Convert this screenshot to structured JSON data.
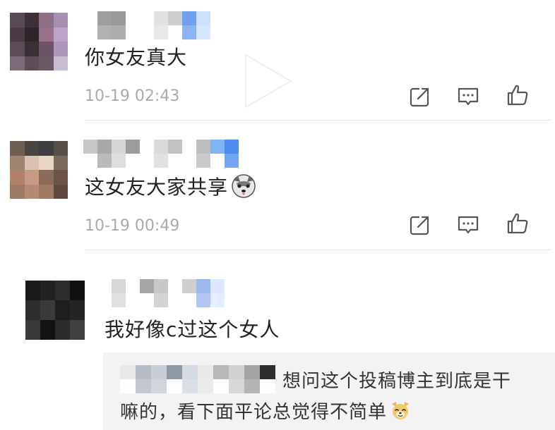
{
  "comments": [
    {
      "text": "你女友真大",
      "timestamp": "10-19 02:43",
      "avatar": [
        "#5a4a54",
        "#3d3038",
        "#8e6f86",
        "#a78fb0",
        "#4a3b45",
        "#2e2529",
        "#9b6e8c",
        "#bfa3c4",
        "#5b4c58",
        "#3a2f36",
        "#6e5265",
        "#ae98b8",
        "#7b6a78",
        "#5c4d59",
        "#6a5a66",
        "#c8bcd0"
      ],
      "name_mosaic": [
        "#ffffff",
        "#9e9e9e",
        "#9a9a9a",
        "#ffffff",
        "#ffffff",
        "#e2e2e2",
        "#cfcfcf",
        "#6fa0f0",
        "#cde0ff"
      ]
    },
    {
      "text": "这女友大家共享",
      "timestamp": "10-19 00:49",
      "emoji": "husky-emoji",
      "avatar": [
        "#6e5f55",
        "#4a4440",
        "#3e3e40",
        "#57504a",
        "#a08470",
        "#d7c3b0",
        "#e8d5c4",
        "#7a6a5c",
        "#b3806a",
        "#c69b83",
        "#8c6a58",
        "#6b5546",
        "#9d7a66",
        "#b48a72",
        "#a07a62",
        "#5e4a3e"
      ],
      "name_mosaic": [
        "#c6c6c6",
        "#a9a9a9",
        "#d6d6d6",
        "#9c9c9c",
        "#ffffff",
        "#d9d9d9",
        "#c2c2c2",
        "#ffffff",
        "#bdbdbd",
        "#7fb4f5",
        "#4d8df0"
      ]
    },
    {
      "text": "我好像c过这个女人",
      "avatar": [
        "#1a1a1a",
        "#222222",
        "#2c2c2c",
        "#111111",
        "#2e2e2e",
        "#3a3a3a",
        "#1e1e1e",
        "#242424",
        "#383838",
        "#121212",
        "#2b2b2b",
        "#404040"
      ],
      "name_mosaic": [
        "#ffffff",
        "#d8d8d8",
        "#ffffff",
        "#a5a5a5",
        "#c8c8c8",
        "#ffffff",
        "#cfcfcf",
        "#9db8ef",
        "#dde8ff"
      ]
    }
  ],
  "reply": {
    "line1": "想问这个投稿博主到底是干",
    "line2": "嘛的，看下面平论总觉得不简单",
    "emoji": "dog-face-emoji",
    "name_mosaic": [
      "#e9e9e9",
      "#b6bcc6",
      "#c9ced6",
      "#8f98a6",
      "#d5dae2",
      "#e9e9e9",
      "#b8b8b8",
      "#d0d0d0",
      "#a4a4a4",
      "#2e2e2e"
    ]
  },
  "icons": {
    "share": "share-icon",
    "comment": "comment-icon",
    "like": "thumbs-up-icon",
    "play": "play-icon"
  },
  "colors": {
    "text": "#222222",
    "timestamp": "#aaaaaa",
    "icon": "#555555",
    "divider": "#e6e6e6",
    "reply_bg": "#f3f3f3"
  }
}
